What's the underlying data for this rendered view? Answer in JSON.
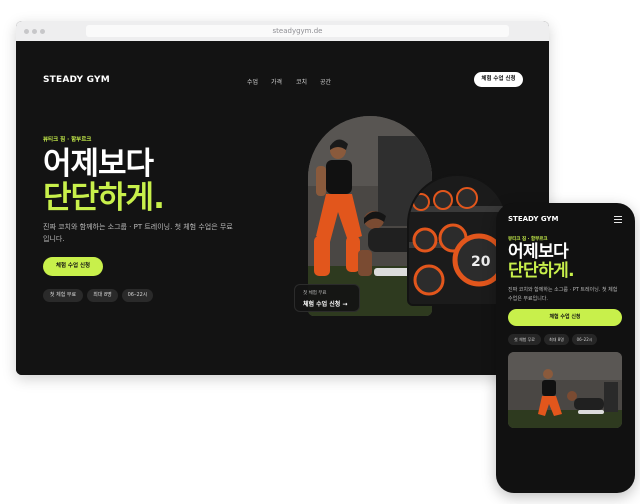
{
  "browser": {
    "url": "steadygym.de"
  },
  "site": {
    "logo": "STEADY GYM",
    "nav": [
      "수업",
      "가격",
      "코치",
      "공간"
    ],
    "cta_top": "체험 수업 신청",
    "eyebrow": "뷰티크 짐 · 함부르크",
    "headline_line1": "어제보다",
    "headline_line2": "단단하게.",
    "subtext": "진짜 코치와 함께하는 소그룹 · PT 트레이닝. 첫 체험 수업은 무료입니다.",
    "cta_main": "체험 수업 신청",
    "chips": [
      "첫 체험 무료",
      "최대 8명",
      "06–22시"
    ],
    "card_small": "첫 체험 무료",
    "card_title": "체험 수업 신청 →"
  },
  "mobile": {
    "logo": "STEADY GYM",
    "eyebrow": "뷰티크 짐 · 함부르크",
    "headline_line1": "어제보다",
    "headline_line2": "단단하게.",
    "subtext": "진짜 코치와 함께하는 소그룹 · PT 트레이닝. 첫 체험 수업은 무료입니다.",
    "cta": "체험 수업 신청",
    "chips": [
      "첫 체험 무료",
      "최대 8명",
      "06–22시"
    ]
  },
  "colors": {
    "background": "#131313",
    "accent": "#c8f04b",
    "chip": "#2a2a2a"
  },
  "icons": {
    "menu": "hamburger-menu-icon",
    "arrow": "arrow-right-icon"
  }
}
